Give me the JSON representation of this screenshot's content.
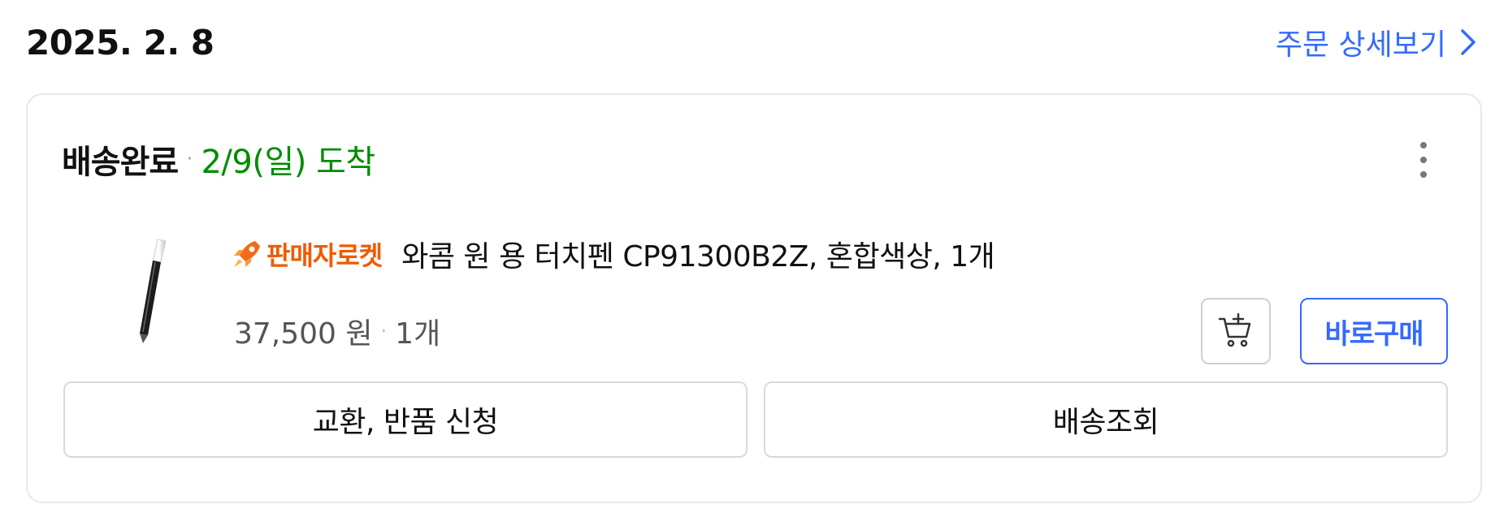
{
  "order": {
    "date": "2025. 2. 8",
    "detail_link_label": "주문 상세보기"
  },
  "shipment": {
    "status": "배송완료",
    "arrival": "2/9(일) 도착"
  },
  "product": {
    "badge_label": "판매자로켓",
    "name": "와콤 원 용 터치펜 CP91300B2Z, 혼합색상, 1개",
    "price": "37,500 원",
    "quantity": "1개",
    "image_icon": "stylus-pen-image"
  },
  "actions": {
    "cart_icon": "add-to-cart-icon",
    "buy_now_label": "바로구매",
    "return_label": "교환, 반품 신청",
    "tracking_label": "배송조회"
  },
  "colors": {
    "accent": "#346aff",
    "arrival_green": "#008c00",
    "badge_orange": "#f05a00"
  }
}
